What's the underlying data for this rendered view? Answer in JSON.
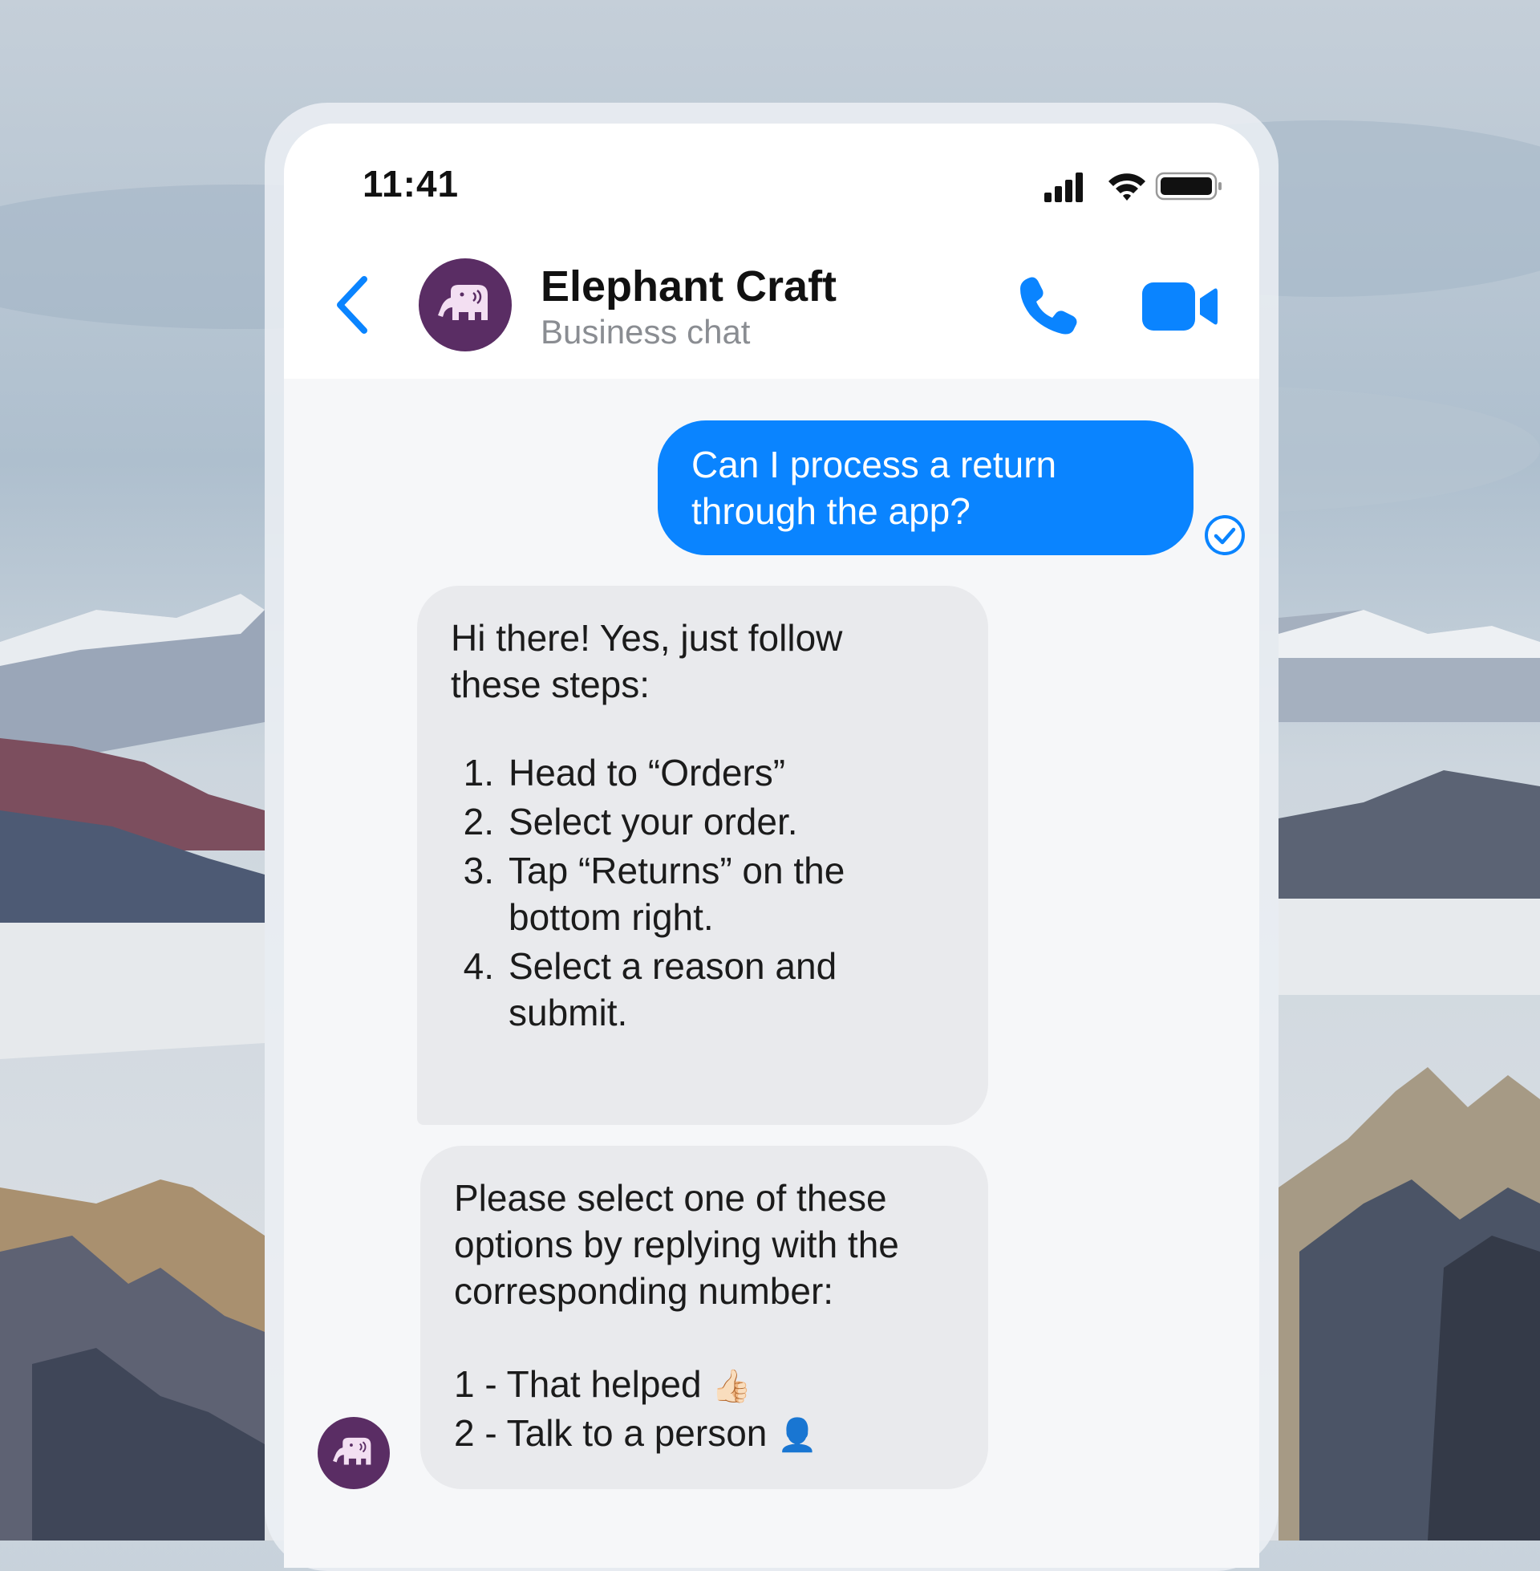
{
  "status_bar": {
    "time": "11:41",
    "icons": [
      "cellular-signal-icon",
      "wifi-icon",
      "battery-icon"
    ]
  },
  "header": {
    "contact_name": "Elephant Craft",
    "contact_subtitle": "Business chat",
    "avatar_icon": "elephant-icon",
    "actions": [
      "phone-call-icon",
      "video-call-icon"
    ]
  },
  "colors": {
    "accent": "#0a84ff",
    "avatar_bg": "#5a2d64",
    "incoming_bubble": "#e9eaed"
  },
  "messages": {
    "outgoing": {
      "line1": "Can I process a return",
      "line2": "through the app?"
    },
    "incoming_1": {
      "intro_line1": "Hi there! Yes, just follow",
      "intro_line2": "these steps:",
      "steps": [
        {
          "num": "1.",
          "text": "Head to “Orders”"
        },
        {
          "num": "2.",
          "text": "Select your order."
        },
        {
          "num": "3.",
          "text": "Tap “Returns” on the bottom right."
        },
        {
          "num": "4.",
          "text": "Select a reason and submit."
        }
      ]
    },
    "incoming_2": {
      "line1": "Please select one of these",
      "line2": "options by replying with the",
      "line3": "corresponding number:",
      "option1": "1 - That helped",
      "option1_emoji": "👍🏻",
      "option2": "2 - Talk to a person",
      "option2_emoji": "👤"
    }
  }
}
